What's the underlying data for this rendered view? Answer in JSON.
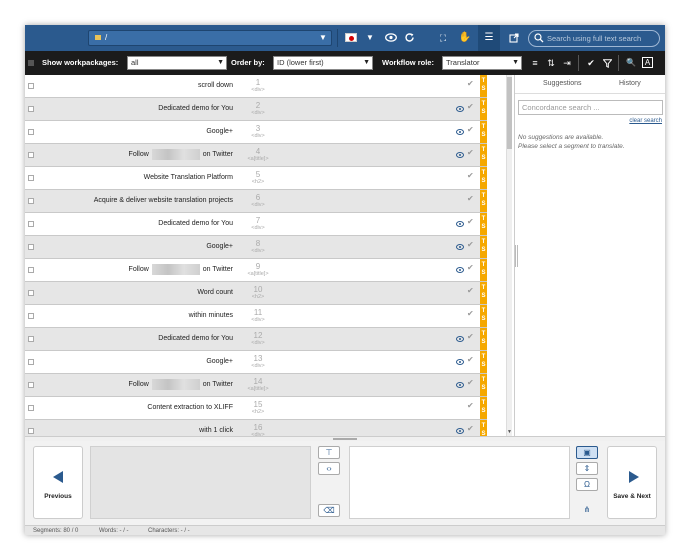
{
  "topbar": {
    "path": "/",
    "search_placeholder": "Search using full text search"
  },
  "filterbar": {
    "workpackages_label": "Show workpackages:",
    "workpackages_value": "all",
    "order_label": "Order by:",
    "order_value": "ID (lower first)",
    "role_label": "Workflow role:",
    "role_value": "Translator"
  },
  "segments": [
    {
      "source": "scroll down",
      "number": "1",
      "tag": "<div>",
      "eye": false,
      "blurred": false
    },
    {
      "source": "Dedicated demo for You",
      "number": "2",
      "tag": "<div>",
      "eye": true,
      "blurred": false
    },
    {
      "source": "Google+",
      "number": "3",
      "tag": "<div>",
      "eye": true,
      "blurred": false
    },
    {
      "source_before": "Follow",
      "source_after": "on Twitter",
      "number": "4",
      "tag": "<a[title]>",
      "eye": true,
      "blurred": true
    },
    {
      "source": "Website Translation Platform",
      "number": "5",
      "tag": "<h2>",
      "eye": false,
      "blurred": false
    },
    {
      "source": "Acquire & deliver website translation projects",
      "number": "6",
      "tag": "<div>",
      "eye": false,
      "blurred": false
    },
    {
      "source": "Dedicated demo for You",
      "number": "7",
      "tag": "<div>",
      "eye": true,
      "blurred": false
    },
    {
      "source": "Google+",
      "number": "8",
      "tag": "<div>",
      "eye": true,
      "blurred": false
    },
    {
      "source_before": "Follow",
      "source_after": "on Twitter",
      "number": "9",
      "tag": "<a[title]>",
      "eye": true,
      "blurred": true
    },
    {
      "source": "Word count",
      "number": "10",
      "tag": "<h2>",
      "eye": false,
      "blurred": false
    },
    {
      "source": "within minutes",
      "number": "11",
      "tag": "<div>",
      "eye": false,
      "blurred": false
    },
    {
      "source": "Dedicated demo for You",
      "number": "12",
      "tag": "<div>",
      "eye": true,
      "blurred": false
    },
    {
      "source": "Google+",
      "number": "13",
      "tag": "<div>",
      "eye": true,
      "blurred": false
    },
    {
      "source_before": "Follow",
      "source_after": "on Twitter",
      "number": "14",
      "tag": "<a[title]>",
      "eye": true,
      "blurred": true
    },
    {
      "source": "Content extraction to XLIFF",
      "number": "15",
      "tag": "<h2>",
      "eye": false,
      "blurred": false
    },
    {
      "source": "with 1 click",
      "number": "16",
      "tag": "<div>",
      "eye": true,
      "blurred": false
    }
  ],
  "status_letters": [
    "T",
    "S"
  ],
  "right_panel": {
    "tab_suggestions": "Suggestions",
    "tab_history": "History",
    "concordance_placeholder": "Concordance search ...",
    "clear_search": "clear search",
    "no_suggestions_line1": "No suggestions are available.",
    "no_suggestions_line2": "Please select a segment to translate."
  },
  "editor": {
    "previous_label": "Previous",
    "save_next_label": "Save & Next"
  },
  "statusbar": {
    "segments": "Segments: 80 / 0",
    "words": "Words: - / -",
    "characters": "Characters: - / -"
  },
  "colors": {
    "topbar": "#2b5a8e",
    "filterbar": "#1b1b1b",
    "status_column": "#f5a800",
    "accent": "#2b5a8e"
  }
}
